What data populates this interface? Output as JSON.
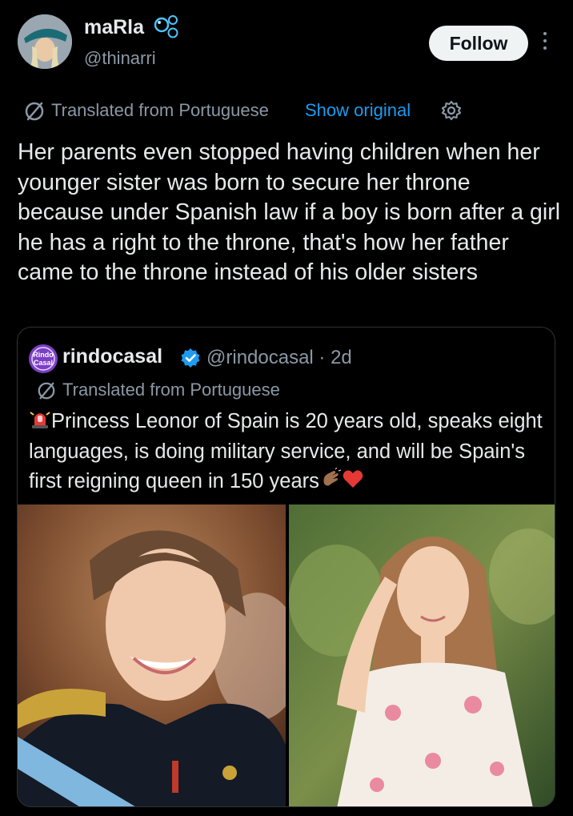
{
  "author": {
    "display_name": "maRla",
    "handle": "@thinarri",
    "badge_icon": "bubbles-icon",
    "follow_label": "Follow"
  },
  "translation": {
    "label": "Translated from Portuguese",
    "show_original": "Show original",
    "accent": "#1d9bf0"
  },
  "tweet": {
    "text": "Her parents even stopped having children when her younger sister was born to secure her throne because under Spanish law if a boy is born after a girl he has a right to the throne, that's how her father came to the throne instead of his older sisters"
  },
  "quoted": {
    "avatar_text": "Rindo Casal",
    "name": "rindocasal",
    "handle_time": "@rindocasal · 2d",
    "translated_label": "Translated from Portuguese",
    "text": "Princess Leonor of Spain is 20 years old, speaks eight languages, is doing military service, and will be Spain's first reigning queen in 150 years",
    "emojis": [
      "siren-emoji",
      "clapping-hands-emoji",
      "red-heart-emoji"
    ],
    "images": [
      "uniform-portrait-photo",
      "floral-dress-portrait-photo"
    ]
  }
}
